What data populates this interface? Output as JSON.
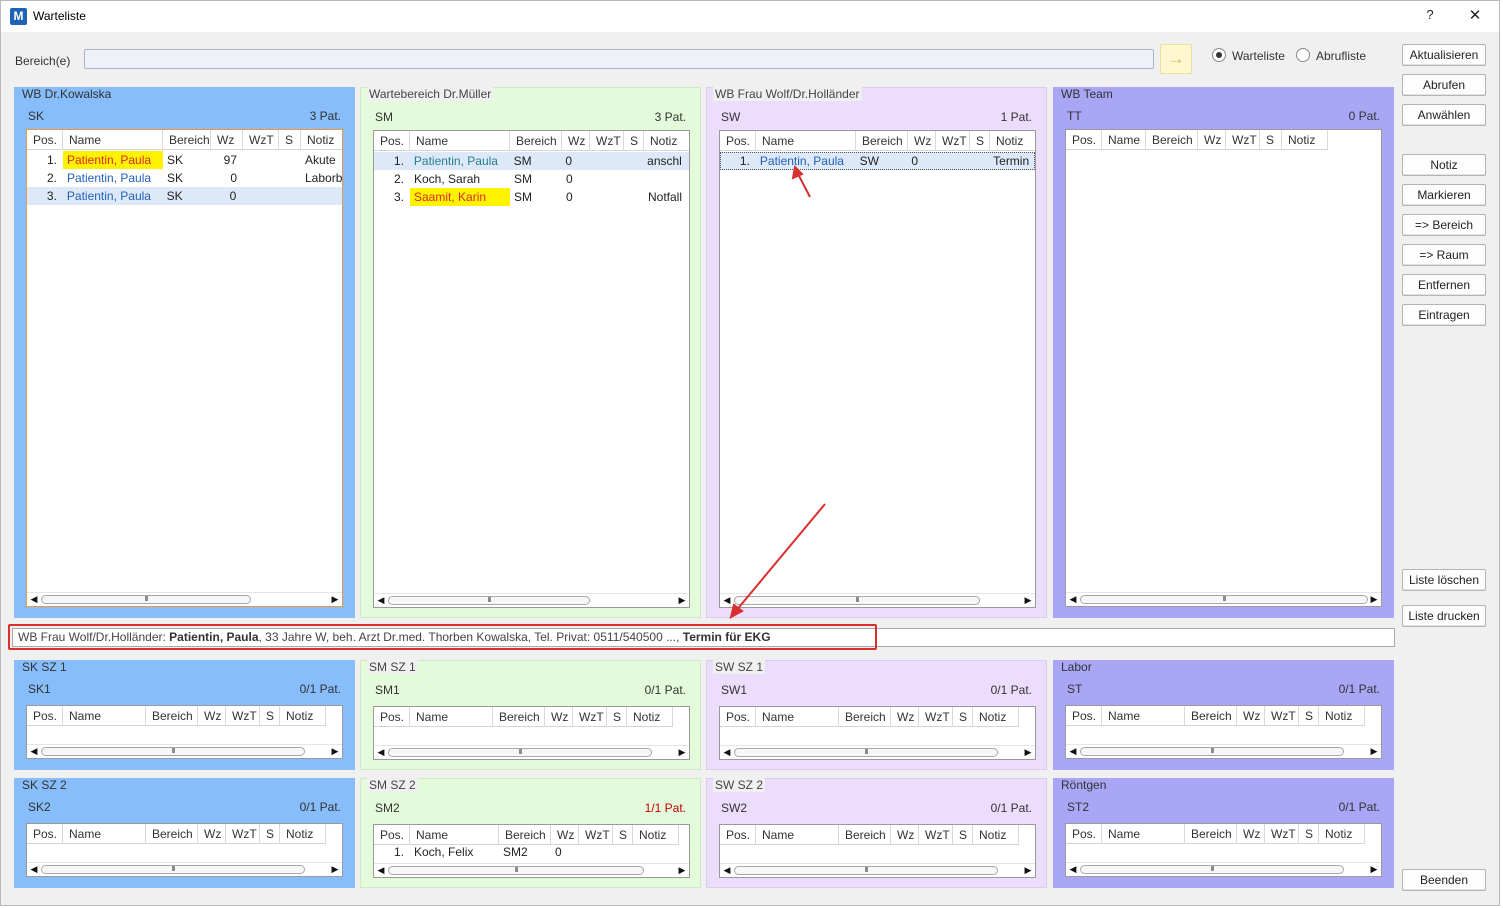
{
  "window": {
    "title": "Warteliste",
    "help": "?",
    "close": "✕",
    "icon_letter": "M"
  },
  "filter": {
    "label": "Bereich(e)",
    "value": "",
    "arrow": "→",
    "radio_warteliste": "Warteliste",
    "radio_abrufliste": "Abrufliste",
    "selected": "Warteliste"
  },
  "buttons": {
    "aktualisieren": "Aktualisieren",
    "abrufen": "Abrufen",
    "anwaehlen": "Anwählen",
    "notiz": "Notiz",
    "markieren": "Markieren",
    "bereich": "=> Bereich",
    "raum": "=> Raum",
    "entfernen": "Entfernen",
    "eintragen": "Eintragen",
    "liste_loeschen": "Liste löschen",
    "liste_drucken": "Liste drucken",
    "beenden": "Beenden"
  },
  "columns": {
    "pos": "Pos.",
    "name": "Name",
    "bereich": "Bereich",
    "wz": "Wz",
    "wzt": "WzT",
    "s": "S",
    "notiz": "Notiz"
  },
  "panels_top": [
    {
      "title": "WB Dr.Kowalska",
      "code": "SK",
      "count": "3 Pat.",
      "rows": [
        {
          "pos": "1.",
          "name": "Patientin, Paula",
          "bereich": "SK",
          "wz": "97",
          "wzt": "",
          "s": "",
          "notiz": "Akute"
        },
        {
          "pos": "2.",
          "name": "Patientin, Paula",
          "bereich": "SK",
          "wz": "0",
          "wzt": "",
          "s": "",
          "notiz": "Laborb"
        },
        {
          "pos": "3.",
          "name": "Patientin, Paula",
          "bereich": "SK",
          "wz": "0",
          "wzt": "",
          "s": "",
          "notiz": ""
        }
      ]
    },
    {
      "title": "Wartebereich Dr.Müller",
      "code": "SM",
      "count": "3 Pat.",
      "rows": [
        {
          "pos": "1.",
          "name": "Patientin, Paula",
          "bereich": "SM",
          "wz": "0",
          "wzt": "",
          "s": "",
          "notiz": "anschl"
        },
        {
          "pos": "2.",
          "name": "Koch, Sarah",
          "bereich": "SM",
          "wz": "0",
          "wzt": "",
          "s": "",
          "notiz": ""
        },
        {
          "pos": "3.",
          "name": "Saamit, Karin",
          "bereich": "SM",
          "wz": "0",
          "wzt": "",
          "s": "",
          "notiz": "Notfall"
        }
      ]
    },
    {
      "title": "WB Frau Wolf/Dr.Holländer",
      "code": "SW",
      "count": "1 Pat.",
      "rows": [
        {
          "pos": "1.",
          "name": "Patientin, Paula",
          "bereich": "SW",
          "wz": "0",
          "wzt": "",
          "s": "",
          "notiz": "Termin"
        }
      ]
    },
    {
      "title": "WB Team",
      "code": "TT",
      "count": "0 Pat.",
      "rows": []
    }
  ],
  "info_bar": {
    "prefix": "WB Frau Wolf/Dr.Holländer: ",
    "name": "Patientin, Paula",
    "details": ", 33 Jahre W, beh. Arzt Dr.med. Thorben Kowalska, Tel. Privat: 0511/540500 ..., ",
    "termin": "Termin für EKG"
  },
  "panels_bottom": [
    {
      "title": "SK SZ 1",
      "code": "SK1",
      "count": "0/1 Pat.",
      "rows": []
    },
    {
      "title": "SM SZ 1",
      "code": "SM1",
      "count": "0/1 Pat.",
      "rows": []
    },
    {
      "title": "SW SZ 1",
      "code": "SW1",
      "count": "0/1 Pat.",
      "rows": []
    },
    {
      "title": "Labor",
      "code": "ST",
      "count": "0/1 Pat.",
      "rows": []
    },
    {
      "title": "SK SZ 2",
      "code": "SK2",
      "count": "0/1 Pat.",
      "rows": []
    },
    {
      "title": "SM SZ 2",
      "code": "SM2",
      "count": "1/1 Pat.",
      "rows": [
        {
          "pos": "1.",
          "name": "Koch, Felix",
          "bereich": "SM2",
          "wz": "0",
          "wzt": "",
          "s": "",
          "notiz": ""
        }
      ]
    },
    {
      "title": "SW SZ 2",
      "code": "SW2",
      "count": "0/1 Pat.",
      "rows": []
    },
    {
      "title": "Röntgen",
      "code": "ST2",
      "count": "0/1 Pat.",
      "rows": []
    }
  ],
  "scroll_grip": "III",
  "colors": {
    "blue_panel": "#86bdfa",
    "green_panel": "#e3fbdb",
    "lavender_panel": "#edddfc",
    "purple_panel": "#aaa6f6",
    "highlight_yellow": "#fff200",
    "annotation_red": "#d92f2f"
  }
}
